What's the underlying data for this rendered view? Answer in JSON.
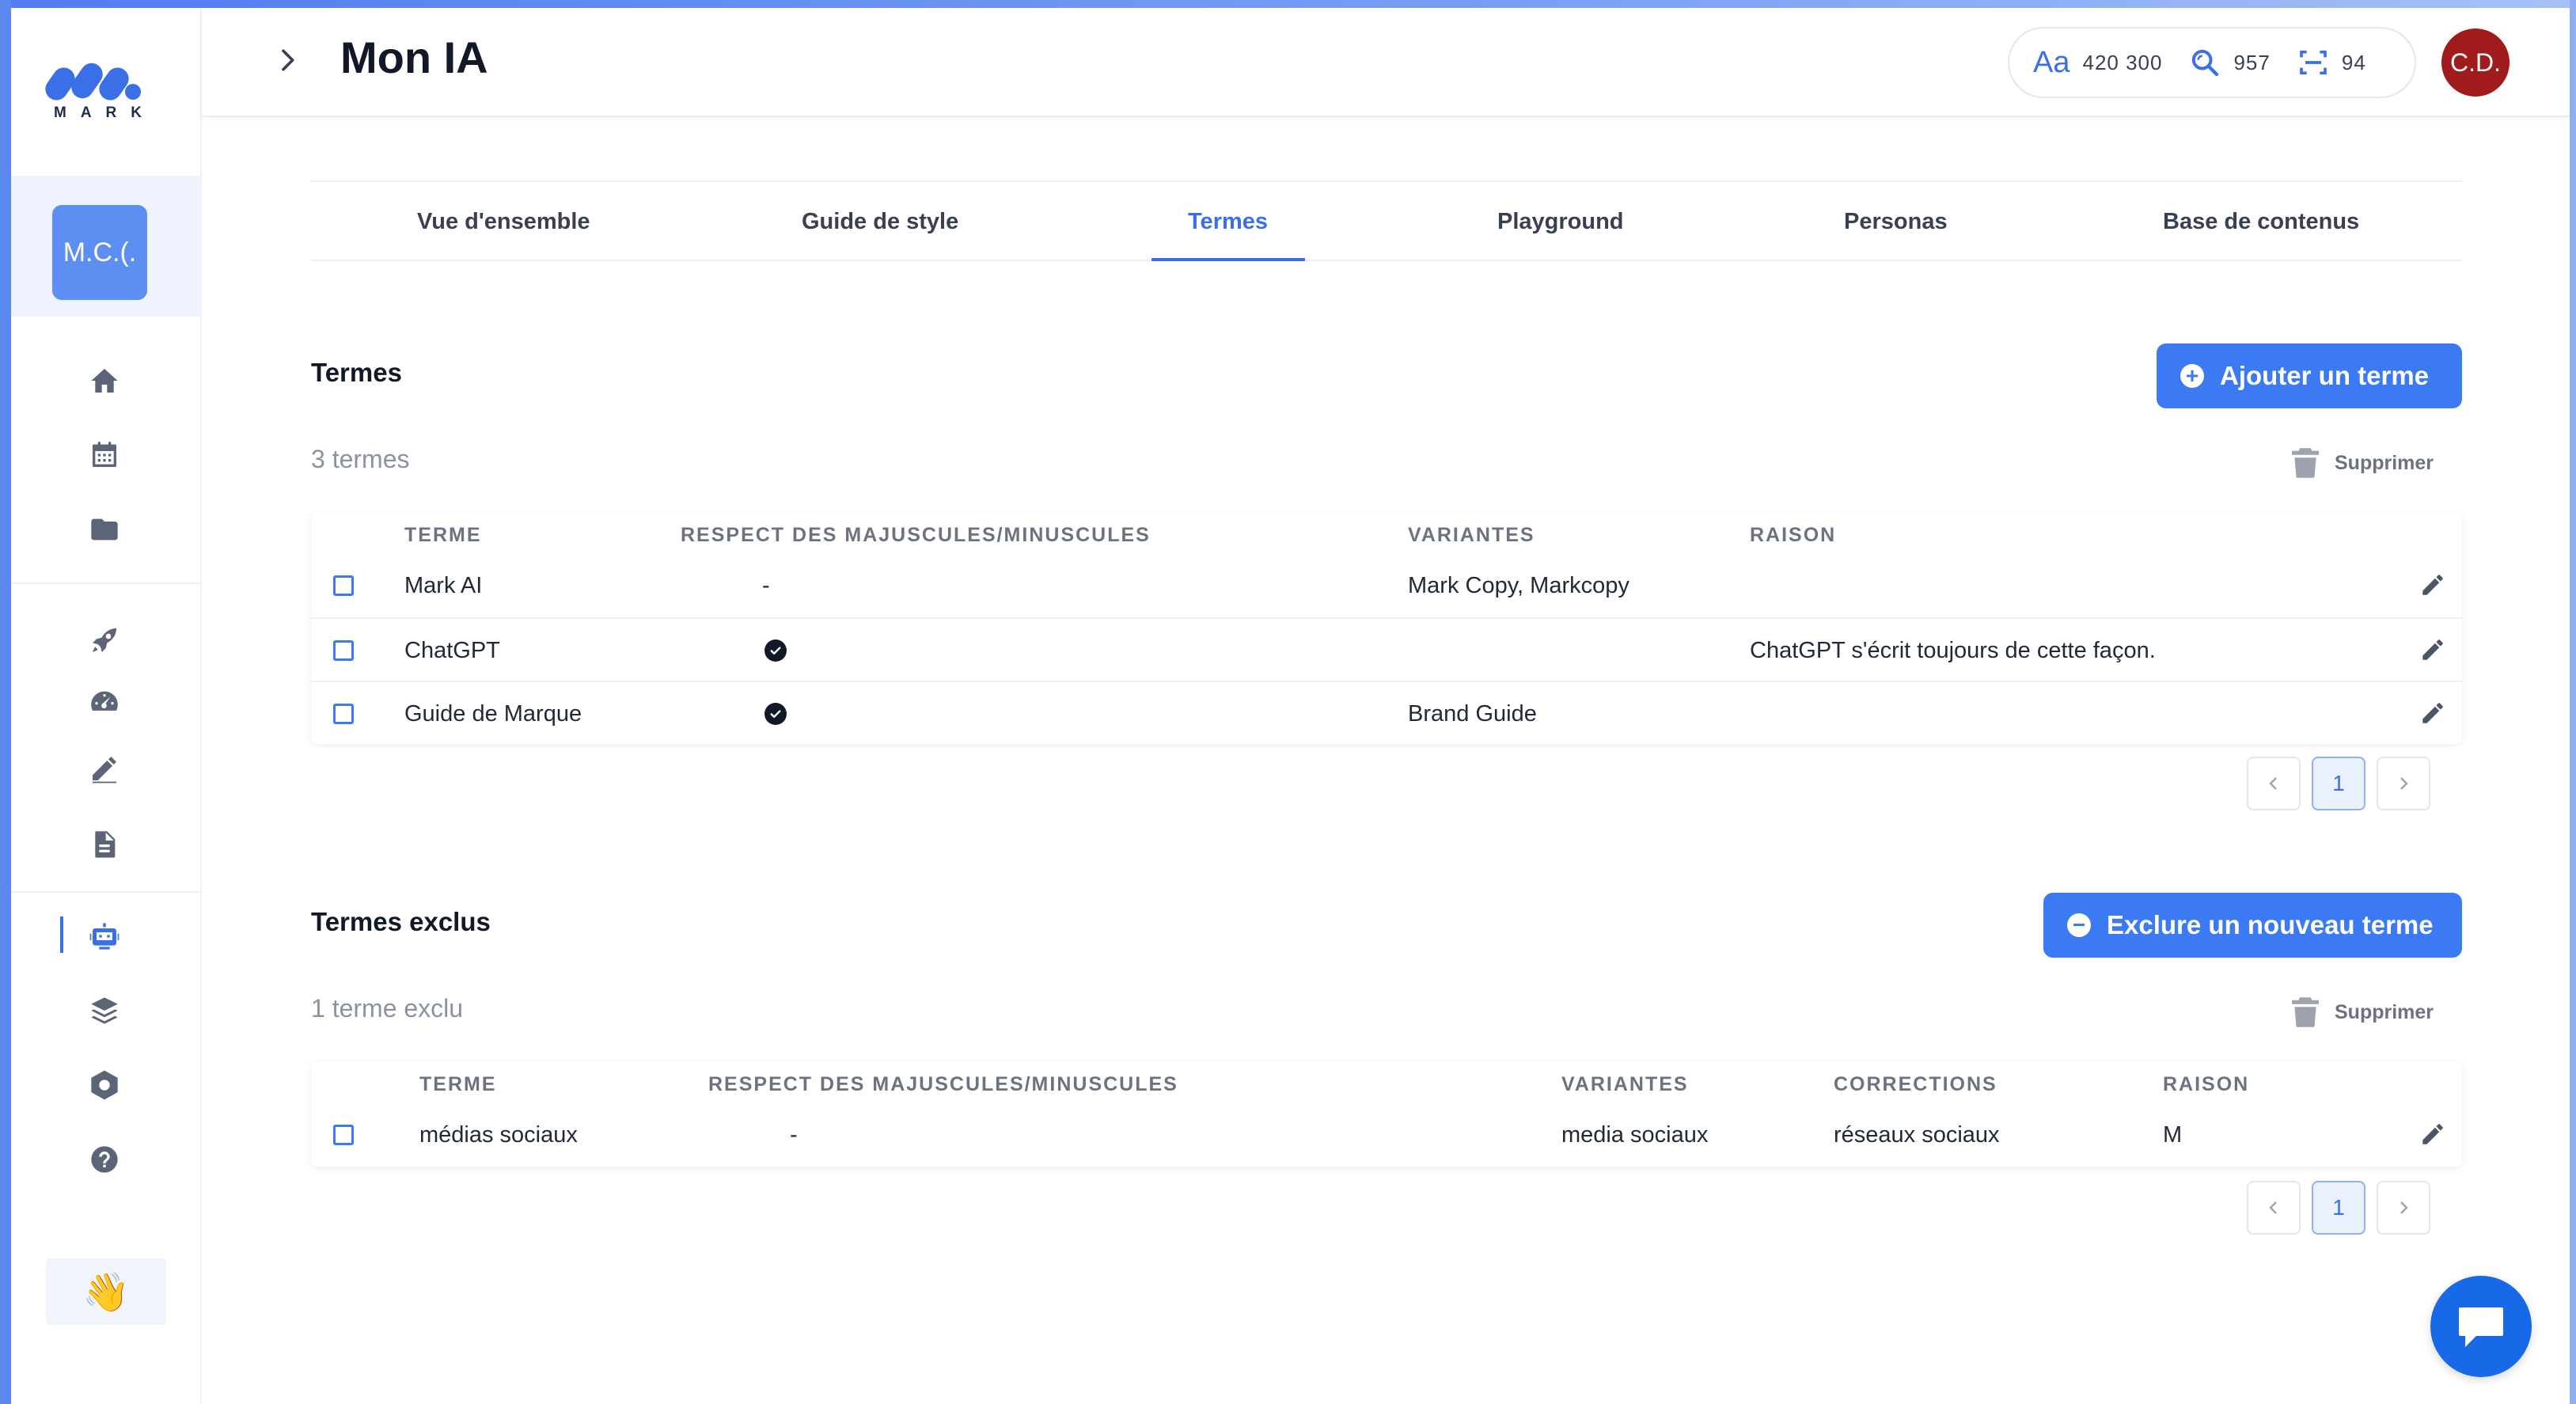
{
  "app": {
    "brand": "MARK",
    "workspace_initials": "M.C.(.",
    "wave_emoji": "👋"
  },
  "header": {
    "title": "Mon IA",
    "stats": [
      {
        "icon": "font-size-icon",
        "value": "420 300"
      },
      {
        "icon": "search-icon",
        "value": "957"
      },
      {
        "icon": "scan-icon",
        "value": "94"
      }
    ],
    "avatar_initials": "C.D."
  },
  "tabs": [
    {
      "label": "Vue d'ensemble",
      "active": false
    },
    {
      "label": "Guide de style",
      "active": false
    },
    {
      "label": "Termes",
      "active": true
    },
    {
      "label": "Playground",
      "active": false
    },
    {
      "label": "Personas",
      "active": false
    },
    {
      "label": "Base de contenus",
      "active": false
    }
  ],
  "terms": {
    "title": "Termes",
    "count": "3 termes",
    "add_label": "Ajouter un terme",
    "delete_label": "Supprimer",
    "columns": [
      "TERME",
      "RESPECT DES MAJUSCULES/MINUSCULES",
      "VARIANTES",
      "RAISON"
    ],
    "rows": [
      {
        "term": "Mark AI",
        "case": "-",
        "case_checked": false,
        "variants": "Mark Copy, Markcopy",
        "reason": ""
      },
      {
        "term": "ChatGPT",
        "case": "",
        "case_checked": true,
        "variants": "",
        "reason": "ChatGPT s'écrit toujours de cette façon."
      },
      {
        "term": "Guide de Marque",
        "case": "",
        "case_checked": true,
        "variants": "Brand Guide",
        "reason": ""
      }
    ],
    "page": "1"
  },
  "excluded": {
    "title": "Termes exclus",
    "count": "1 terme exclu",
    "add_label": "Exclure un nouveau terme",
    "delete_label": "Supprimer",
    "columns": [
      "TERME",
      "RESPECT DES MAJUSCULES/MINUSCULES",
      "VARIANTES",
      "CORRECTIONS",
      "RAISON"
    ],
    "rows": [
      {
        "term": "médias sociaux",
        "case": "-",
        "variants": "media sociaux",
        "corrections": "réseaux sociaux",
        "reason": "M"
      }
    ],
    "page": "1"
  },
  "colors": {
    "accent": "#3b7af2",
    "avatar": "#a01c1c"
  }
}
